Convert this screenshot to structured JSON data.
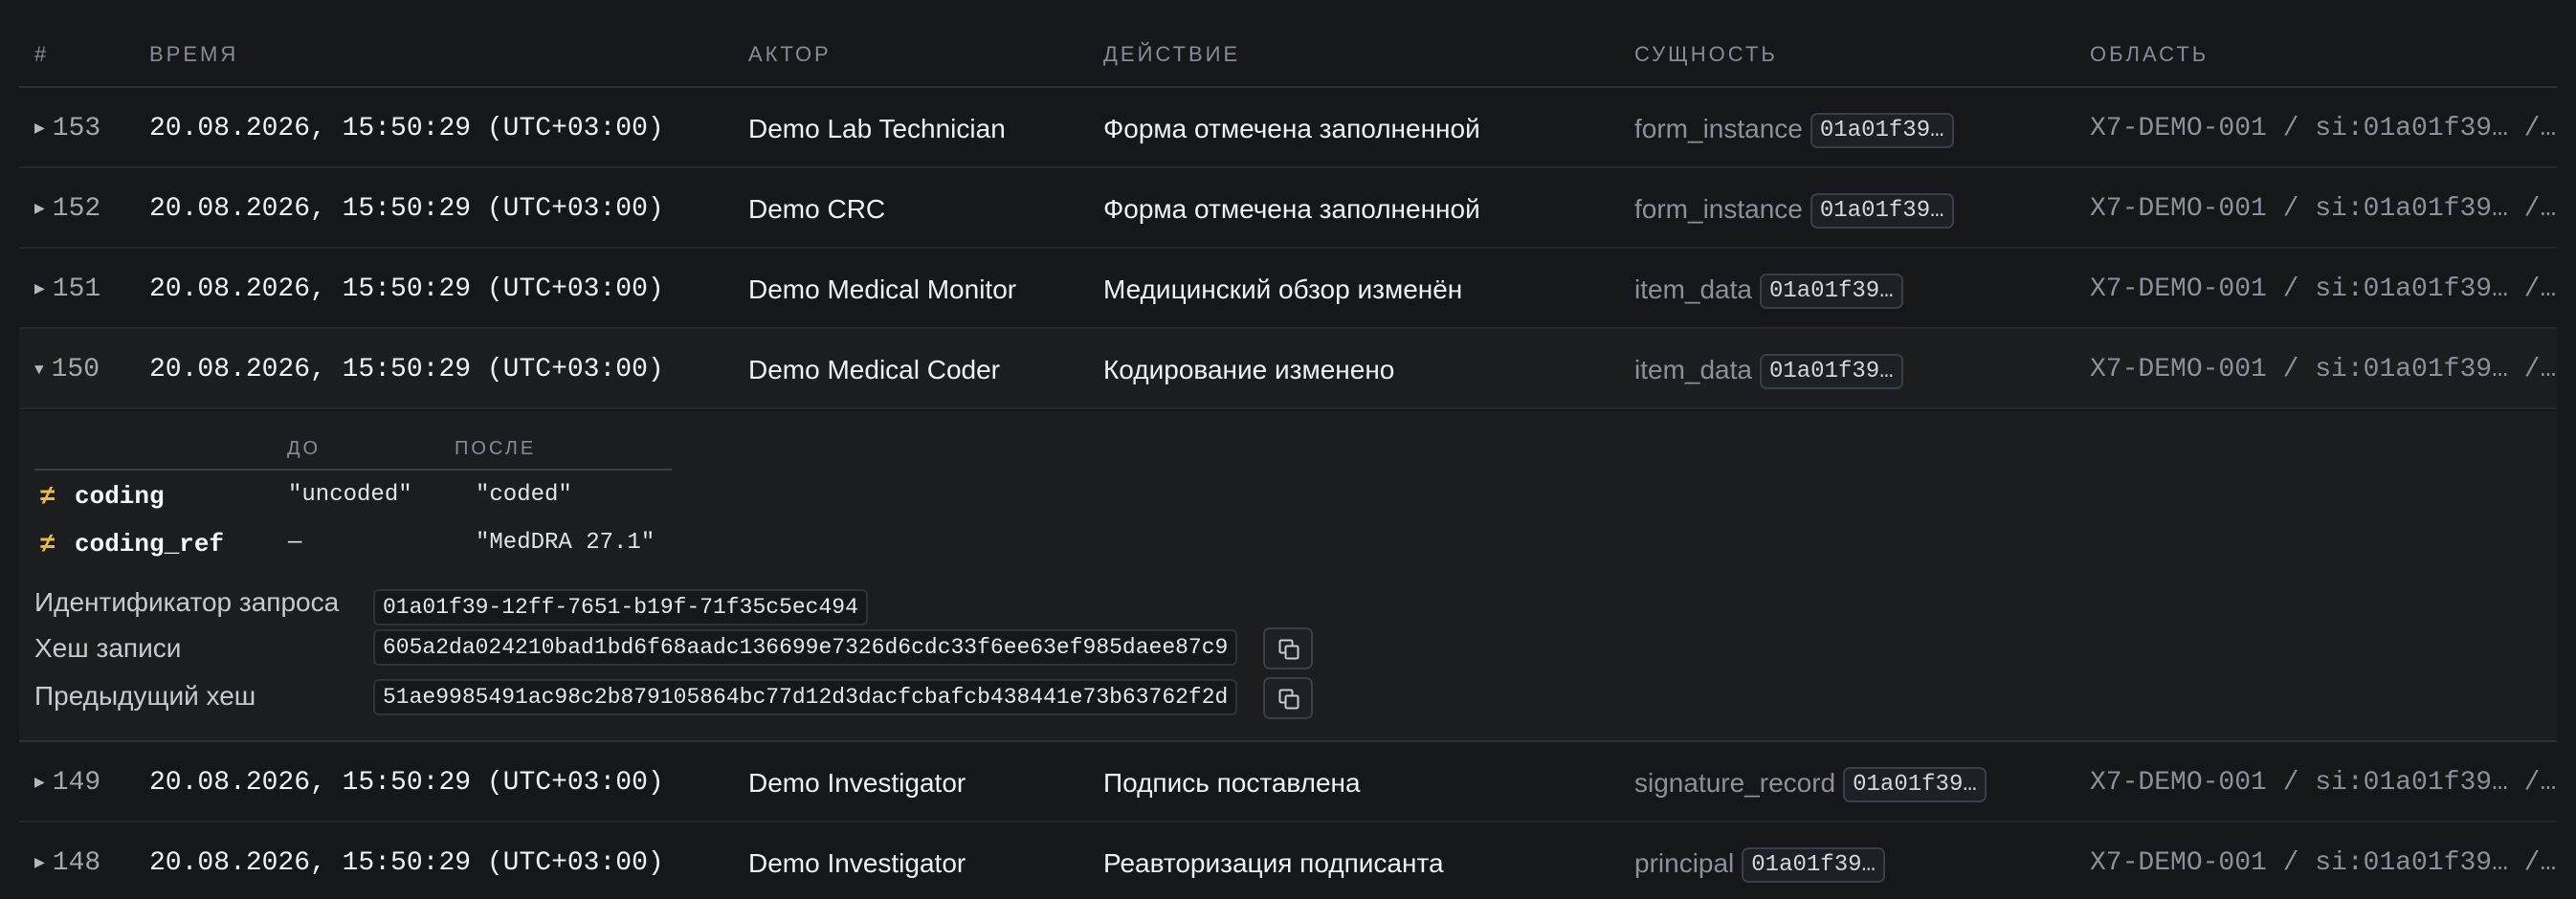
{
  "headers": {
    "num": "#",
    "time": "ВРЕМЯ",
    "actor": "АКТОР",
    "action": "ДЕЙСТВИЕ",
    "entity": "СУЩНОСТЬ",
    "area": "ОБЛАСТЬ"
  },
  "rows": [
    {
      "num": "153",
      "time": "20.08.2026, 15:50:29 (UTC+03:00)",
      "actor": "Demo Lab Technician",
      "action": "Форма отмечена заполненной",
      "entity_type": "form_instance",
      "entity_id": "01a01f39…",
      "area": "X7-DEMO-001 / si:01a01f39… /…"
    },
    {
      "num": "152",
      "time": "20.08.2026, 15:50:29 (UTC+03:00)",
      "actor": "Demo CRC",
      "action": "Форма отмечена заполненной",
      "entity_type": "form_instance",
      "entity_id": "01a01f39…",
      "area": "X7-DEMO-001 / si:01a01f39… /…"
    },
    {
      "num": "151",
      "time": "20.08.2026, 15:50:29 (UTC+03:00)",
      "actor": "Demo Medical Monitor",
      "action": "Медицинский обзор изменён",
      "entity_type": "item_data",
      "entity_id": "01a01f39…",
      "area": "X7-DEMO-001 / si:01a01f39… /…"
    },
    {
      "num": "150",
      "time": "20.08.2026, 15:50:29 (UTC+03:00)",
      "actor": "Demo Medical Coder",
      "action": "Кодирование изменено",
      "entity_type": "item_data",
      "entity_id": "01a01f39…",
      "area": "X7-DEMO-001 / si:01a01f39… /…"
    },
    {
      "num": "149",
      "time": "20.08.2026, 15:50:29 (UTC+03:00)",
      "actor": "Demo Investigator",
      "action": "Подпись поставлена",
      "entity_type": "signature_record",
      "entity_id": "01a01f39…",
      "area": "X7-DEMO-001 / si:01a01f39… /…"
    },
    {
      "num": "148",
      "time": "20.08.2026, 15:50:29 (UTC+03:00)",
      "actor": "Demo Investigator",
      "action": "Реавторизация подписанта",
      "entity_type": "principal",
      "entity_id": "01a01f39…",
      "area": "X7-DEMO-001 / si:01a01f39… /…"
    }
  ],
  "detail": {
    "before_header": "ДО",
    "after_header": "ПОСЛЕ",
    "neq_symbol": "≠",
    "changes": [
      {
        "key": "coding",
        "before": "\"uncoded\"",
        "after": "\"coded\""
      },
      {
        "key": "coding_ref",
        "before": "—",
        "after": "\"MedDRA 27.1\""
      }
    ],
    "request_id_label": "Идентификатор запроса",
    "request_id": "01a01f39-12ff-7651-b19f-71f35c5ec494",
    "hash_label": "Хеш записи",
    "hash": "605a2da024210bad1bd6f68aadc136699e7326d6cdc33f6ee63ef985daee87c9",
    "prev_hash_label": "Предыдущий хеш",
    "prev_hash": "51ae9985491ac98c2b879105864bc77d12d3dacfcbafcb438441e73b63762f2d"
  },
  "icons": {
    "collapsed": "caret-right-icon",
    "expanded": "caret-down-icon",
    "copy": "copy-icon"
  },
  "colors": {
    "background": "#15171b",
    "accent_neq": "#e8b84a",
    "muted": "#8b9099"
  }
}
